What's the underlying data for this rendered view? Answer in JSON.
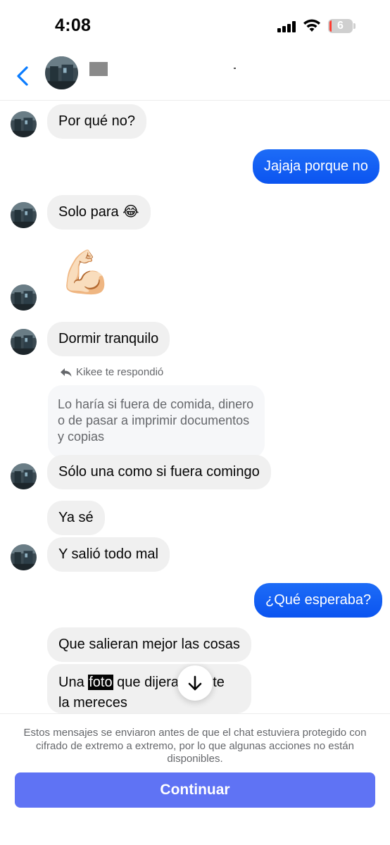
{
  "status_bar": {
    "time": "4:08",
    "battery": "6"
  },
  "conversation": {
    "reply_label": "Kikee te respondió",
    "quoted_text": "Lo haría si fuera de comida, dinero o de pasar a imprimir documentos y copias",
    "messages": {
      "m1": "Por qué no?",
      "m2": "Jajaja porque no",
      "m3": "Solo para 😂",
      "m4_emoji": "💪🏻",
      "m5": "Dormir tranquilo",
      "m6": "Sólo una como si fuera comingo",
      "m7": "Ya sé",
      "m8": "Y salió todo mal",
      "m9": "¿Qué esperaba?",
      "m10": "Que salieran mejor las cosas",
      "m11_part1": "Una ",
      "m11_highlight": "foto",
      "m11_part2": " que dijera",
      "m11_part3": "e, te",
      "m11_line2": "la mereces"
    }
  },
  "footer": {
    "note": "Estos mensajes se enviaron antes de que el chat estuviera protegido con cifrado de extremo a extremo, por lo que algunas acciones no están disponibles.",
    "continue_label": "Continuar"
  },
  "colors": {
    "outgoing_bubble": "#0b5cf5",
    "incoming_bubble": "#f0f0f0",
    "back_chevron": "#0a7cff",
    "continue_button": "#5f73f4"
  },
  "icons": {
    "back": "chevron-left-icon",
    "reply": "reply-arrow-icon",
    "scroll": "arrow-down-icon"
  }
}
